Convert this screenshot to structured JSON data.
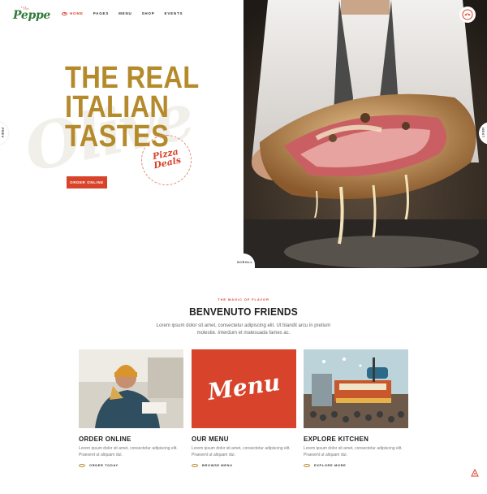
{
  "logo": {
    "prefix": "the",
    "wordmark": "Peppe",
    "brand_color": "#2f7a3a"
  },
  "nav": {
    "items": [
      {
        "label": "HOME",
        "active": true
      },
      {
        "label": "PAGES",
        "active": false
      },
      {
        "label": "MENU",
        "active": false
      },
      {
        "label": "SHOP",
        "active": false
      },
      {
        "label": "EVENTS",
        "active": false
      }
    ]
  },
  "hero": {
    "title_lines": [
      "THE REAL",
      "ITALIAN",
      "TASTES"
    ],
    "background_script": "Olive",
    "badge_lines": [
      "Pizza",
      "Deals"
    ],
    "cta_label": "ORDER ONLINE",
    "left_tab_label": "PREV",
    "right_tab_label": "NEXT",
    "scroll_label": "SCROLL",
    "accent_color": "#d8432b",
    "gold_color": "#b58a2b"
  },
  "section": {
    "eyebrow": "THE MAGIC OF FLAVOR",
    "title": "BENVENUTO FRIENDS",
    "description": "Lorem ipsum dolor sit amet, consectetur adipiscing elit. Ut blandit arcu in pretium molestie. Interdum et malesuada fames ac."
  },
  "cards": [
    {
      "title": "ORDER ONLINE",
      "description": "Lorem ipsum dolor sit amet, consectetur adipiscing elit. Praesent ut aliquam dui.",
      "link": "ORDER TODAY"
    },
    {
      "title": "OUR MENU",
      "description": "Lorem ipsum dolor sit amet, consectetur adipiscing elit. Praesent ut aliquam dui.",
      "link": "BROWSE MENU",
      "image_text": "Menu"
    },
    {
      "title": "EXPLORE KITCHEN",
      "description": "Lorem ipsum dolor sit amet, consectetur adipiscing elit. Praesent ut aliquam dui.",
      "link": "EXPLORE MORE"
    }
  ],
  "icons": {
    "cart": "pizza-cart-icon",
    "floating": "pizza-slice-icon"
  }
}
